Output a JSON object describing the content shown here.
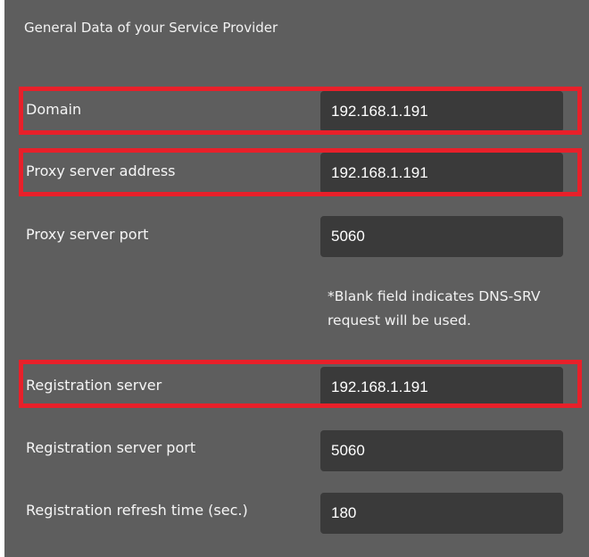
{
  "section": {
    "title": "General Data of your Service Provider"
  },
  "fields": {
    "domain": {
      "label": "Domain",
      "value": "192.168.1.191"
    },
    "proxy_address": {
      "label": "Proxy server address",
      "value": "192.168.1.191"
    },
    "proxy_port": {
      "label": "Proxy server port",
      "value": "5060"
    },
    "registration_server": {
      "label": "Registration server",
      "value": "192.168.1.191"
    },
    "registration_port": {
      "label": "Registration server port",
      "value": "5060"
    },
    "refresh_time": {
      "label": "Registration refresh time (sec.)",
      "value": "180"
    }
  },
  "note": "*Blank field indicates DNS-SRV request will be used.",
  "colors": {
    "panel_background": "#5e5e5e",
    "field_background": "#3a3a3a",
    "highlight": "#e8202a"
  }
}
